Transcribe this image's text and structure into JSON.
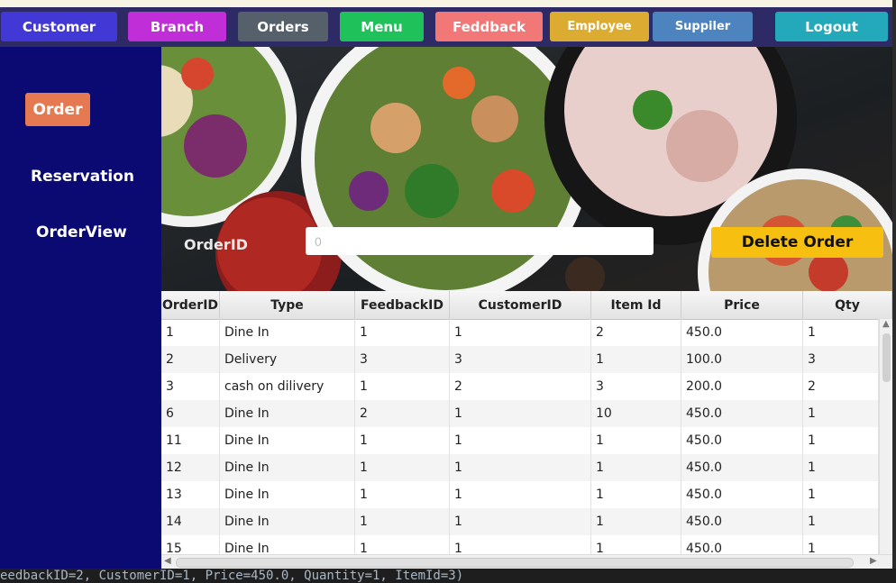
{
  "nav": {
    "customer": "Customer",
    "branch": "Branch",
    "orders": "Orders",
    "menu": "Menu",
    "feedback": "Feddback",
    "employee": "Employee",
    "supplier": "Suppiler",
    "logout": "Logout"
  },
  "sidebar": {
    "order": "Order",
    "reservation": "Reservation",
    "orderview": "OrderView"
  },
  "form": {
    "orderid_label": "OrderID",
    "orderid_placeholder": "0",
    "delete_label": "Delete Order"
  },
  "table": {
    "headers": [
      "OrderID",
      "Type",
      "FeedbackID",
      "CustomerID",
      "Item Id",
      "Price",
      "Qty"
    ],
    "rows": [
      [
        "1",
        "Dine In",
        "1",
        "1",
        "2",
        "450.0",
        "1"
      ],
      [
        "2",
        "Delivery",
        "3",
        "3",
        "1",
        "100.0",
        "3"
      ],
      [
        "3",
        "cash on dilivery",
        "1",
        "2",
        "3",
        "200.0",
        "2"
      ],
      [
        "6",
        "Dine In",
        "2",
        "1",
        "10",
        "450.0",
        "1"
      ],
      [
        "11",
        "Dine In",
        "1",
        "1",
        "1",
        "450.0",
        "1"
      ],
      [
        "12",
        "Dine In",
        "1",
        "1",
        "1",
        "450.0",
        "1"
      ],
      [
        "13",
        "Dine In",
        "1",
        "1",
        "1",
        "450.0",
        "1"
      ],
      [
        "14",
        "Dine In",
        "1",
        "1",
        "1",
        "450.0",
        "1"
      ],
      [
        "15",
        "Dine In",
        "1",
        "1",
        "1",
        "450.0",
        "1"
      ]
    ]
  },
  "console": {
    "text": "eedbackID=2, CustomerID=1, Price=450.0, Quantity=1, ItemId=3)"
  },
  "colors": {
    "sidebar_bg": "#0b0a73",
    "nav_customer": "#4138d6",
    "nav_branch": "#c02ed8",
    "nav_orders": "#56606b",
    "nav_menu": "#1fc25a",
    "nav_feedback": "#f27777",
    "nav_employee": "#dcab31",
    "nav_supplier": "#4d84c0",
    "nav_logout": "#23a9b9",
    "order_button": "#e57a52",
    "delete_button": "#f7bf0f"
  }
}
